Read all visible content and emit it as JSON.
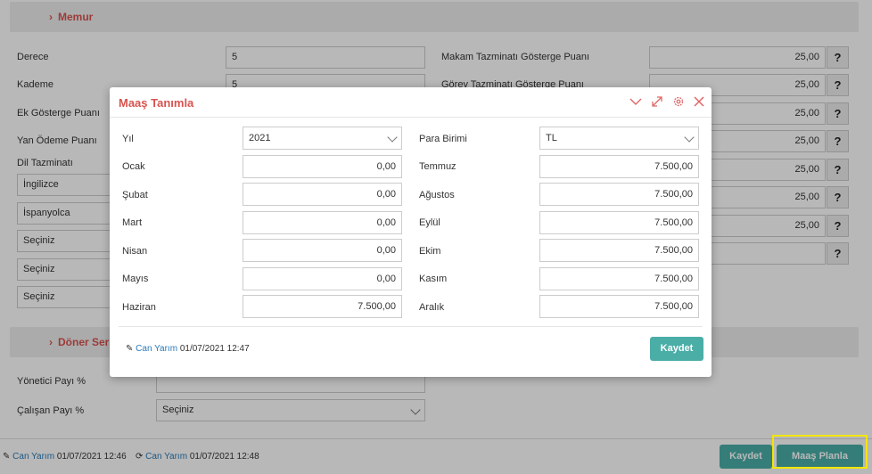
{
  "section1": {
    "title": "Memur"
  },
  "left_fields": [
    {
      "label": "Derece",
      "value": "5"
    },
    {
      "label": "Kademe",
      "value": "5"
    },
    {
      "label": "Ek Gösterge Puanı",
      "value": ""
    },
    {
      "label": "Yan Ödeme Puanı",
      "value": ""
    }
  ],
  "dil_tazminati": {
    "label": "Dil Tazminatı",
    "items": [
      "İngilizce",
      "İspanyolca",
      "Seçiniz",
      "Seçiniz",
      "Seçiniz"
    ]
  },
  "right_fields": [
    {
      "label": "Makam Tazminatı Gösterge Puanı",
      "value": "25,00"
    },
    {
      "label": "Görev Tazminatı Gösterge Puanı",
      "value": "25,00"
    },
    {
      "label": "",
      "value": "25,00"
    },
    {
      "label": "",
      "value": "25,00"
    },
    {
      "label": "",
      "value": "25,00"
    },
    {
      "label": "",
      "value": "25,00"
    },
    {
      "label": "",
      "value": "25,00"
    },
    {
      "label": "",
      "value": ""
    }
  ],
  "help_label": "?",
  "section2": {
    "title": "Döner Ser",
    "yonetici_label": "Yönetici Payı %",
    "calisan_label": "Çalışan Payı %",
    "calisan_value": "Seçiniz"
  },
  "footer": {
    "user1": "Can Yarım",
    "date1": "01/07/2021 12:46",
    "user2": "Can Yarım",
    "date2": "01/07/2021 12:48",
    "kaydet": "Kaydet",
    "maas_planla": "Maaş Planla"
  },
  "modal": {
    "title": "Maaş Tanımla",
    "yil_label": "Yıl",
    "yil_value": "2021",
    "para_label": "Para Birimi",
    "para_value": "TL",
    "left_months": [
      {
        "label": "Ocak",
        "value": "0,00"
      },
      {
        "label": "Şubat",
        "value": "0,00"
      },
      {
        "label": "Mart",
        "value": "0,00"
      },
      {
        "label": "Nisan",
        "value": "0,00"
      },
      {
        "label": "Mayıs",
        "value": "0,00"
      },
      {
        "label": "Haziran",
        "value": "7.500,00"
      }
    ],
    "right_months": [
      {
        "label": "Temmuz",
        "value": "7.500,00"
      },
      {
        "label": "Ağustos",
        "value": "7.500,00"
      },
      {
        "label": "Eylül",
        "value": "7.500,00"
      },
      {
        "label": "Ekim",
        "value": "7.500,00"
      },
      {
        "label": "Kasım",
        "value": "7.500,00"
      },
      {
        "label": "Aralık",
        "value": "7.500,00"
      }
    ],
    "footer_user": "Can Yarım",
    "footer_date": "01/07/2021 12:47",
    "save_label": "Kaydet"
  },
  "colors": {
    "accent": "#4aaea7",
    "title_red": "#d9534f",
    "link": "#2a7ab8",
    "highlight": "#f3e600"
  }
}
